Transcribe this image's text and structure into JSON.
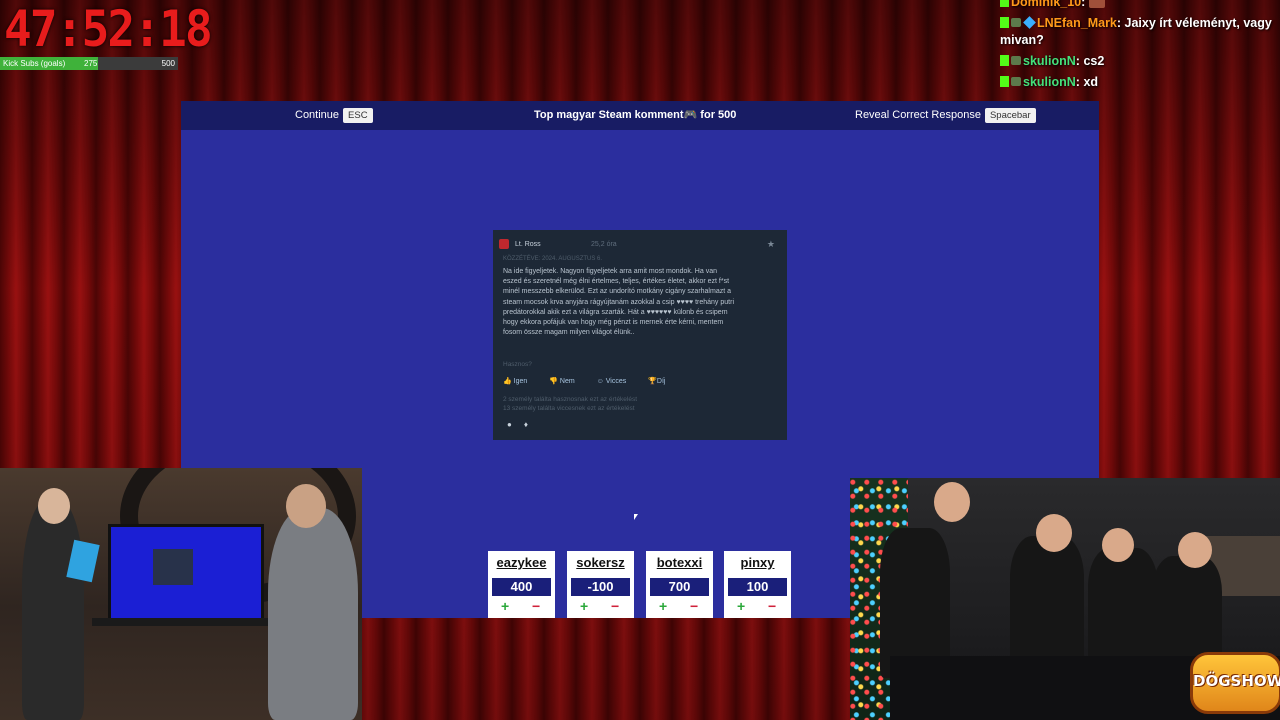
{
  "timer": "47:52:18",
  "subs": {
    "label": "Kick Subs (goals)",
    "current": "275",
    "goal": "500",
    "progress": 0.55
  },
  "chat": [
    {
      "user": "Dominik_10",
      "message": "",
      "color": "#ff9a1a",
      "partial": true
    },
    {
      "user": "LNEfan_Mark",
      "message": "Jaixy írt véleményt, vagy mivan?",
      "color": "#ff9a1a"
    },
    {
      "user": "skulionN",
      "message": "cs2",
      "color": "#44e07a"
    },
    {
      "user": "skulionN",
      "message": "xd",
      "color": "#44e07a"
    }
  ],
  "game": {
    "continue_label": "Continue",
    "continue_key": "ESC",
    "title": "Top magyar Steam komment🎮 for 500",
    "reveal_label": "Reveal Correct Response",
    "reveal_key": "Spacebar"
  },
  "review": {
    "author": "Lt. Ross",
    "hours": "25,2 óra",
    "posted": "KÖZZÉTÉVE: 2024. AUGUSZTUS 6.",
    "text": "Na ide figyeljetek. Nagyon figyeljetek arra amit most mondok. Ha van eszed és szeretnél még élni értelmes, teljes, értékes életet, akkor ezt f*st minél messzebb elkerülöd. Ezt az undorító motkány cigány szarhalmazt a steam mocsok krva anyjára rágyújtanám azokkal a csip ♥♥♥♥ trehány putri predátorokkal akik ezt a világra szarták. Hát a ♥♥♥♥♥♥ külonb és csipem hogy ekkora pofájuk van hogy még pénzt is mernek érte kérni, mentem fosom össze magam milyen világot élünk..",
    "helpful_q": "Hasznos?",
    "btn_yes": "Igen",
    "btn_no": "Nem",
    "btn_funny": "Vicces",
    "btn_award": "Díj",
    "stat1": "2 személy találta hasznosnak ezt az értékelést",
    "stat2": "13 személy találta viccesnek ezt az értékelést"
  },
  "players": [
    {
      "name": "eazykee",
      "score": "400"
    },
    {
      "name": "sokersz",
      "score": "-100"
    },
    {
      "name": "botexxi",
      "score": "700"
    },
    {
      "name": "pinxy",
      "score": "100"
    }
  ],
  "plus_label": "+",
  "minus_label": "−",
  "brand_logo": "DÖGSHOW"
}
